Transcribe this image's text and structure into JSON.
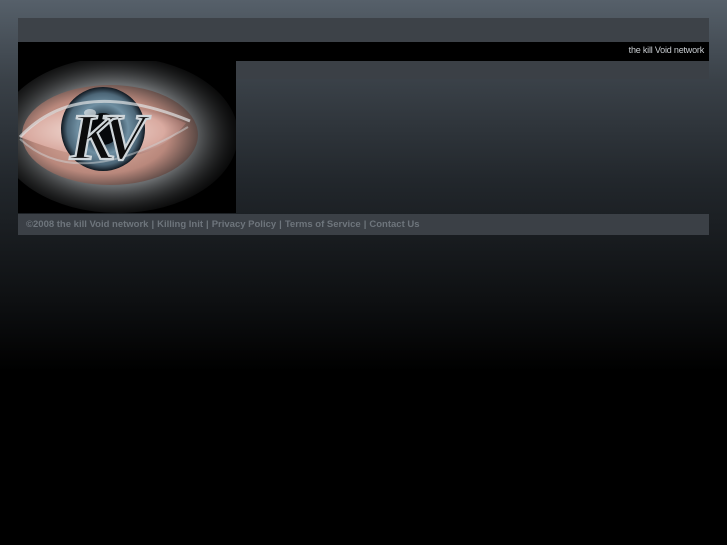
{
  "header": {
    "site_name": "the kill Void network"
  },
  "logo": {
    "letters": "KV",
    "icon": "eye-logo"
  },
  "footer": {
    "copyright": "©2008 the kill Void network",
    "separator": "|",
    "links": [
      "Killing Init",
      "Privacy Policy",
      "Terms of Service",
      "Contact Us"
    ]
  },
  "colors": {
    "footer_text": "#6e757c",
    "site_name_text": "#c9cdd1"
  }
}
